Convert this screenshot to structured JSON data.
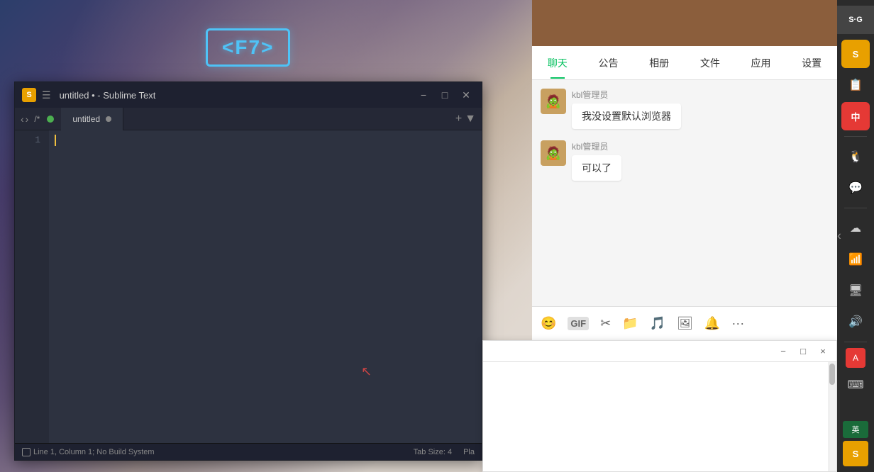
{
  "wallpaper": {
    "bg": "fantasy dark"
  },
  "f7_key": {
    "label": "<F7>"
  },
  "sublime": {
    "title": "untitled • - Sublime Text",
    "logo": "S",
    "path": "/*",
    "tab_name": "untitled",
    "status_line": "Line 1, Column 1; No Build System",
    "tab_size": "Tab Size: 4",
    "encoding": "Pla",
    "line_number": "1"
  },
  "chat": {
    "header_bg": "#8b5e3c",
    "nav_items": [
      {
        "label": "聊天",
        "active": true
      },
      {
        "label": "公告",
        "active": false
      },
      {
        "label": "相册",
        "active": false
      },
      {
        "label": "文件",
        "active": false
      },
      {
        "label": "应用",
        "active": false
      },
      {
        "label": "设置",
        "active": false
      }
    ],
    "messages": [
      {
        "sender": "kbl管理员",
        "avatar": "🧟",
        "text": "我没设置默认浏览器"
      },
      {
        "sender": "kbl管理员",
        "avatar": "🧟",
        "text": "可以了"
      }
    ],
    "toolbar_icons": [
      "😊",
      "GIF",
      "✂",
      "📁",
      "🎵",
      "🖼",
      "🔔",
      "···"
    ]
  },
  "right_sidebar": {
    "icons": [
      {
        "name": "sg-logo",
        "symbol": "S·G"
      },
      {
        "name": "sublime-s-icon",
        "symbol": "S"
      },
      {
        "name": "notepad-icon",
        "symbol": "📋"
      },
      {
        "name": "chinese-icon",
        "symbol": "中"
      },
      {
        "name": "qq-icon",
        "symbol": "🐧"
      },
      {
        "name": "wechat-icon",
        "symbol": "💬"
      },
      {
        "name": "cloud-icon",
        "symbol": "☁"
      },
      {
        "name": "wifi-icon",
        "symbol": "📶"
      },
      {
        "name": "monitor-icon",
        "symbol": "🖥"
      },
      {
        "name": "volume-icon",
        "symbol": "🔊"
      },
      {
        "name": "input-red-icon",
        "symbol": "A"
      },
      {
        "name": "keyboard-icon",
        "symbol": "⌨"
      },
      {
        "name": "lang-en",
        "symbol": "英"
      },
      {
        "name": "sublime-small",
        "symbol": "S"
      }
    ]
  },
  "secondary_window": {
    "min_label": "−",
    "max_label": "□",
    "close_label": "×"
  }
}
